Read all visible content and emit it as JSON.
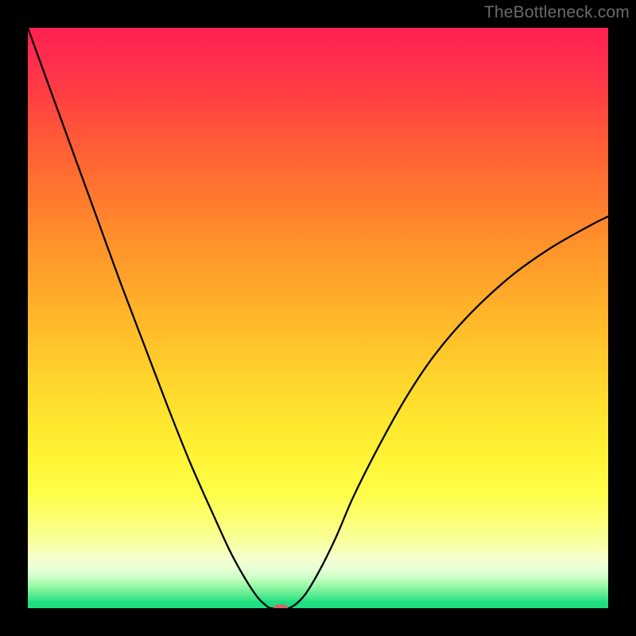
{
  "watermark_text": "TheBottleneck.com",
  "chart_data": {
    "type": "line",
    "title": "",
    "xlabel": "",
    "ylabel": "",
    "xlim": [
      0,
      100
    ],
    "ylim": [
      0,
      100
    ],
    "background_gradient": {
      "orientation": "vertical",
      "stops": [
        {
          "pos": 0.0,
          "color": "#ff2052"
        },
        {
          "pos": 0.5,
          "color": "#ffb72a"
        },
        {
          "pos": 0.8,
          "color": "#fefe47"
        },
        {
          "pos": 0.95,
          "color": "#c4ffc0"
        },
        {
          "pos": 1.0,
          "color": "#1ede80"
        }
      ]
    },
    "series": [
      {
        "name": "bottleneck-curve",
        "color": "#000000",
        "x": [
          0.0,
          4.0,
          8.0,
          12.0,
          16.0,
          20.0,
          24.0,
          28.0,
          32.0,
          35.0,
          37.5,
          39.5,
          41.0,
          42.0,
          45.0,
          47.5,
          50.0,
          53.0,
          56.0,
          60.0,
          65.0,
          70.0,
          76.0,
          83.0,
          90.0,
          97.0,
          100.0
        ],
        "y": [
          100.0,
          89.0,
          78.0,
          67.0,
          56.0,
          45.5,
          35.0,
          25.0,
          16.0,
          9.5,
          5.0,
          2.0,
          0.5,
          0.0,
          0.0,
          2.0,
          6.0,
          12.0,
          19.0,
          27.0,
          36.0,
          43.5,
          50.5,
          57.0,
          62.0,
          66.0,
          67.5
        ]
      }
    ],
    "marker": {
      "x": 43.5,
      "y": 0.0,
      "shape": "rounded-rect",
      "color": "#d86464"
    },
    "annotations": []
  }
}
